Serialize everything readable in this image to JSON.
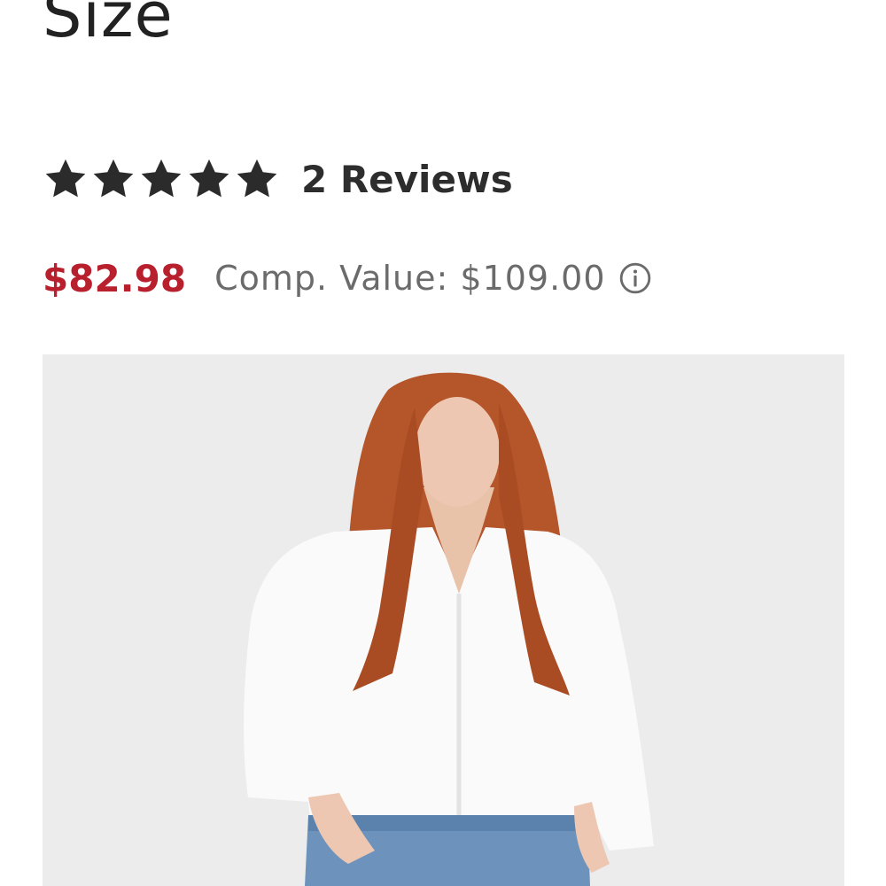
{
  "product": {
    "title_fragment": "Size",
    "rating": {
      "stars": 5,
      "max_stars": 5,
      "reviews_label": "2 Reviews"
    },
    "price": "$82.98",
    "comp_value_label": "Comp. Value: $109.00"
  },
  "icons": {
    "star": "star-icon",
    "info": "info-icon"
  },
  "colors": {
    "price": "#b8202e",
    "comp_text": "#6b6b6b",
    "star": "#2b2b2b",
    "image_bg": "#ececec"
  }
}
